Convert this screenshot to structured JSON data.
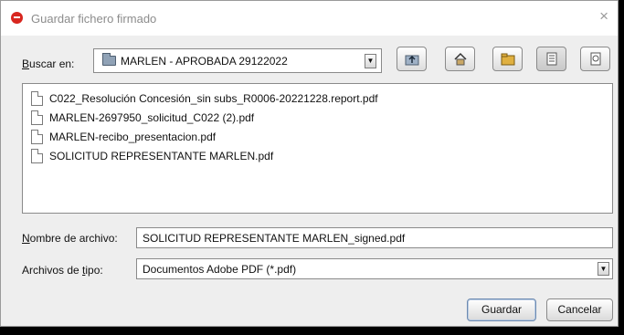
{
  "window": {
    "title": "Guardar fichero firmado",
    "close_glyph": "×"
  },
  "toolbar": {
    "look_in_label_prefix": "B",
    "look_in_label_rest": "uscar en:",
    "current_folder": "MARLEN - APROBADA 29122022",
    "combo_arrow": "▼",
    "buttons": [
      {
        "name": "up-one-level-button",
        "icon": "folder-up-icon"
      },
      {
        "name": "home-button",
        "icon": "home-icon"
      },
      {
        "name": "new-folder-button",
        "icon": "new-folder-icon"
      },
      {
        "name": "list-view-button",
        "icon": "list-view-icon",
        "selected": true
      },
      {
        "name": "details-view-button",
        "icon": "details-view-icon"
      }
    ]
  },
  "files": [
    "C022_Resolución Concesión_sin subs_R0006-20221228.report.pdf",
    "MARLEN-2697950_solicitud_C022 (2).pdf",
    "MARLEN-recibo_presentacion.pdf",
    "SOLICITUD REPRESENTANTE MARLEN.pdf"
  ],
  "form": {
    "filename_label_prefix": "N",
    "filename_label_rest": "ombre de archivo:",
    "filename_value": "SOLICITUD REPRESENTANTE MARLEN_signed.pdf",
    "filetype_label_before": "Archivos de ",
    "filetype_label_mnemonic": "t",
    "filetype_label_after": "ipo:",
    "filetype_value": "Documentos Adobe PDF (*.pdf)"
  },
  "actions": {
    "save_label": "Guardar",
    "cancel_label": "Cancelar"
  },
  "colors": {
    "app_icon": "#d8261f",
    "dialog_bg": "#eeeeee",
    "title_text": "#8c8c8c"
  }
}
